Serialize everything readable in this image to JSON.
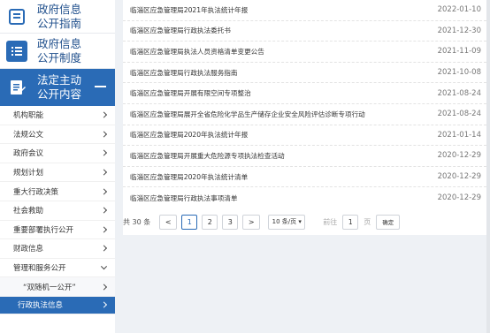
{
  "sidebar": {
    "sections": [
      {
        "line1": "政府信息",
        "line2": "公开指南"
      },
      {
        "line1": "政府信息",
        "line2": "公开制度"
      },
      {
        "line1": "法定主动",
        "line2": "公开内容"
      }
    ],
    "items": [
      {
        "label": "机构职能"
      },
      {
        "label": "法规公文"
      },
      {
        "label": "政府会议"
      },
      {
        "label": "规划计划"
      },
      {
        "label": "重大行政决策"
      },
      {
        "label": "社会救助"
      },
      {
        "label": "重要部署执行公开"
      },
      {
        "label": "财政信息"
      },
      {
        "label": "管理和服务公开"
      },
      {
        "label": "“双随机一公开”"
      },
      {
        "label": "行政执法信息"
      }
    ]
  },
  "list": [
    {
      "title": "临淄区应急管理局2021年执法统计年报",
      "date": "2022-01-10"
    },
    {
      "title": "临淄区应急管理局行政执法委托书",
      "date": "2021-12-30"
    },
    {
      "title": "临淄区应急管理局执法人员资格清单变更公告",
      "date": "2021-11-09"
    },
    {
      "title": "临淄区应急管理局行政执法服务指南",
      "date": "2021-10-08"
    },
    {
      "title": "临淄区应急管理局开展有限空间专项整治",
      "date": "2021-08-24"
    },
    {
      "title": "临淄区应急管理局展开全省危险化学品生产储存企业安全风险评估诊断专项行动",
      "date": "2021-08-24"
    },
    {
      "title": "临淄区应急管理局2020年执法统计年报",
      "date": "2021-01-14"
    },
    {
      "title": "临淄区应急管理局开展重大危险源专项执法检查活动",
      "date": "2020-12-29"
    },
    {
      "title": "临淄区应急管理局2020年执法统计清单",
      "date": "2020-12-29"
    },
    {
      "title": "临淄区应急管理局行政执法事项清单",
      "date": "2020-12-29"
    }
  ],
  "pager": {
    "total": "共 30 条",
    "prev": "<",
    "pages": [
      "1",
      "2",
      "3"
    ],
    "next": ">",
    "page_size": "10 条/页 ▾",
    "goto_label": "前往",
    "goto_value": "1",
    "page_suffix": "页",
    "confirm": "确定"
  }
}
